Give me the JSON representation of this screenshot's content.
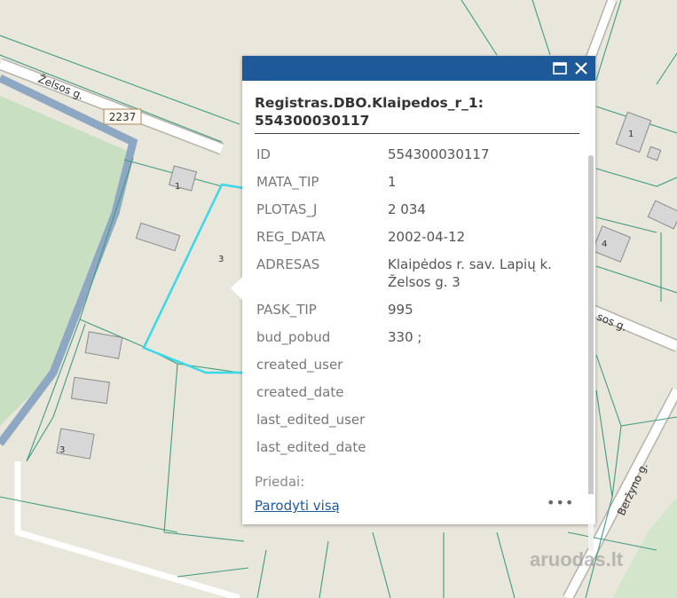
{
  "map": {
    "roads": [
      {
        "name": "Želsos g.",
        "badge": "2237"
      },
      {
        "name": "sos g."
      },
      {
        "name": "Beržyno g."
      }
    ],
    "house_numbers": [
      "1",
      "3",
      "1",
      "4",
      "3"
    ],
    "colors": {
      "background": "#e9e6dc",
      "selected_parcel": "#3ad8e8",
      "water": "#8ea8c4",
      "field": "#c9dfc2",
      "parcel_line": "#3f9c7f"
    }
  },
  "popup": {
    "title": "Registras.DBO.Klaipedos_r_1: 554300030117",
    "header_color": "#1e5a9a",
    "maximize_icon": "maximize-icon",
    "close_icon": "close-icon",
    "attributes": [
      {
        "key": "ID",
        "value": "554300030117"
      },
      {
        "key": "MATA_TIP",
        "value": "1"
      },
      {
        "key": "PLOTAS_J",
        "value": "2 034"
      },
      {
        "key": "REG_DATA",
        "value": "2002-04-12"
      },
      {
        "key": "ADRESAS",
        "value": "Klaipėdos r. sav. Lapių k. Želsos g. 3"
      },
      {
        "key": "PASK_TIP",
        "value": "995"
      },
      {
        "key": "bud_pobud",
        "value": "330 ;"
      },
      {
        "key": "created_user",
        "value": ""
      },
      {
        "key": "created_date",
        "value": ""
      },
      {
        "key": "last_edited_user",
        "value": ""
      },
      {
        "key": "last_edited_date",
        "value": ""
      }
    ],
    "attachments_label": "Priedai:",
    "show_all_link": "Parodyti visą",
    "more_label": "•••"
  },
  "watermark": "aruodas.lt"
}
